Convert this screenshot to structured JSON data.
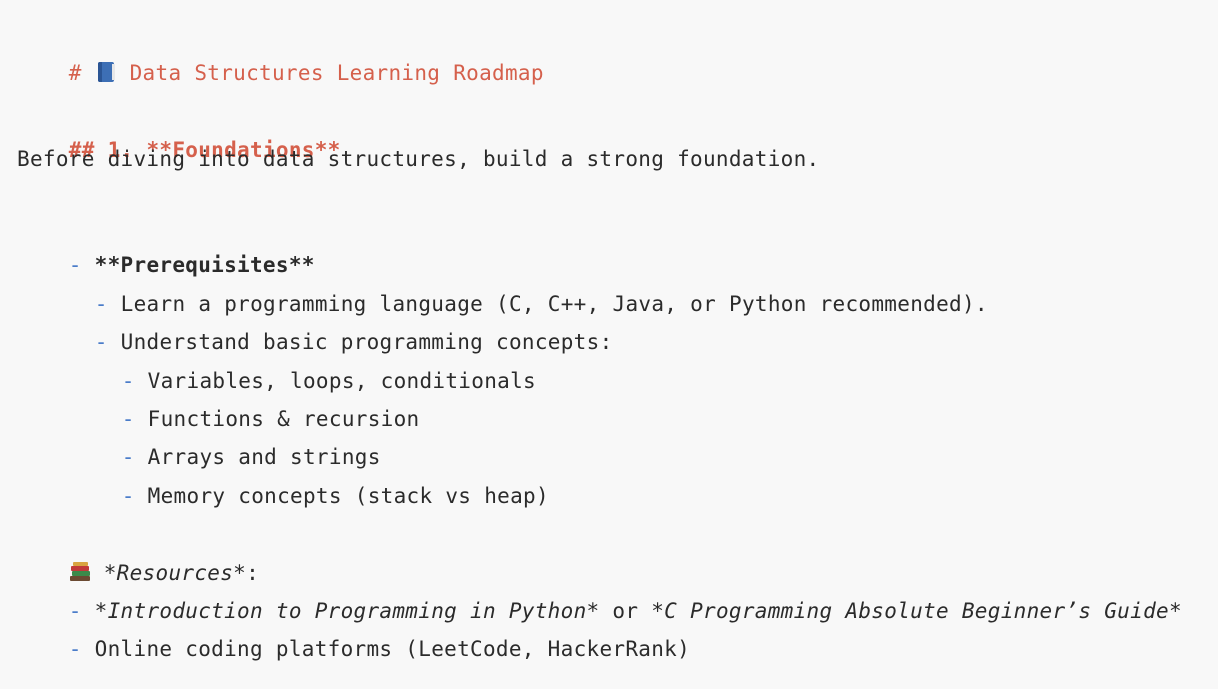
{
  "document": {
    "title_prefix": "# ",
    "title_icon": "blue-book-icon",
    "title_text": " Data Structures Learning Roadmap",
    "section_heading_prefix": "## 1. ",
    "section_heading_text": "**Foundations**",
    "intro": "Before diving into data structures, build a strong foundation.",
    "prereq_dash": "- ",
    "prereq_label": "**Prerequisites**",
    "prereq_items": [
      {
        "dash": "- ",
        "text": "Learn a programming language (C, C++, Java, or Python recommended)."
      },
      {
        "dash": "- ",
        "text": "Understand basic programming concepts:"
      }
    ],
    "concept_items": [
      {
        "dash": "- ",
        "text": "Variables, loops, conditionals"
      },
      {
        "dash": "- ",
        "text": "Functions & recursion"
      },
      {
        "dash": "- ",
        "text": "Arrays and strings"
      },
      {
        "dash": "- ",
        "text": "Memory concepts (stack vs heap)"
      }
    ],
    "resources_icon": "books-stack-icon",
    "resources_label": " *Resources*",
    "resources_colon": ":",
    "resource_items": [
      {
        "dash": "- ",
        "part1": "*Introduction to Programming in Python*",
        "mid": " or ",
        "part2": "*C Programming Absolute Beginner’s Guide*"
      },
      {
        "dash": "- ",
        "text": "Online coding platforms (LeetCode, HackerRank)"
      }
    ]
  },
  "colors": {
    "background": "#f8f8f8",
    "heading": "#d5604c",
    "list_marker": "#4a7cc9",
    "text": "#2b2b2b"
  }
}
